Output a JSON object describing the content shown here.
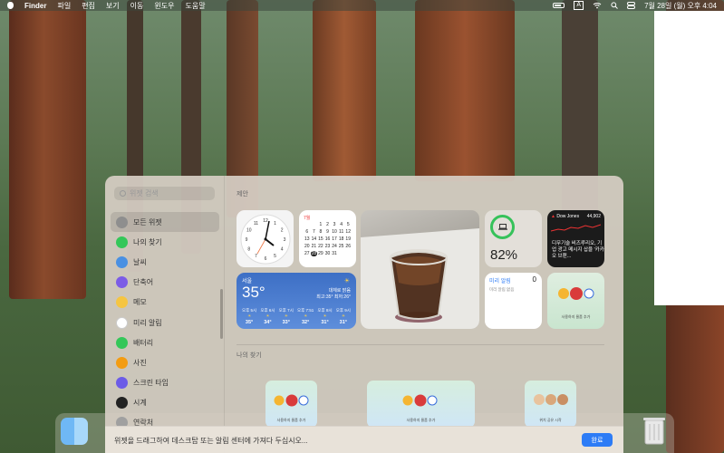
{
  "menubar": {
    "app": "Finder",
    "menus": [
      "파일",
      "편집",
      "보기",
      "이동",
      "윈도우",
      "도움말"
    ],
    "clock": "7월 28일 (월) 오후 4:04",
    "input_indicator": "A"
  },
  "search": {
    "placeholder": "위젯 검색"
  },
  "sidebar": {
    "items": [
      {
        "label": "모든 위젯",
        "icon": "widgets-icon",
        "color": "#8e8e8e"
      },
      {
        "label": "나의 찾기",
        "icon": "find-my-icon",
        "color": "#34c759"
      },
      {
        "label": "날씨",
        "icon": "weather-icon",
        "color": "#4a90e2"
      },
      {
        "label": "단축어",
        "icon": "shortcuts-icon",
        "color": "#7b5ce6"
      },
      {
        "label": "메모",
        "icon": "notes-icon",
        "color": "#f5c542"
      },
      {
        "label": "미리 알림",
        "icon": "reminders-icon",
        "color": "#ffffff"
      },
      {
        "label": "배터리",
        "icon": "battery-icon",
        "color": "#34c759"
      },
      {
        "label": "사진",
        "icon": "photos-icon",
        "color": "#f39c12"
      },
      {
        "label": "스크린 타임",
        "icon": "screen-time-icon",
        "color": "#6c5ce7"
      },
      {
        "label": "시계",
        "icon": "clock-icon",
        "color": "#222222"
      },
      {
        "label": "연락처",
        "icon": "contacts-icon",
        "color": "#a0a0a0"
      }
    ]
  },
  "sections": {
    "suggested": "제안",
    "findmy": "나의 찾기"
  },
  "calendar": {
    "month": "7월",
    "days": [
      "",
      "",
      "1",
      "2",
      "3",
      "4",
      "5",
      "6",
      "7",
      "8",
      "9",
      "10",
      "11",
      "12",
      "13",
      "14",
      "15",
      "16",
      "17",
      "18",
      "19",
      "20",
      "21",
      "22",
      "23",
      "24",
      "25",
      "26",
      "27",
      "28",
      "29",
      "30",
      "31",
      "",
      ""
    ],
    "today": "28"
  },
  "battery": {
    "percent": "82%"
  },
  "stocks": {
    "name": "Dow Jones",
    "value": "44,902",
    "headline": "디무기술 비즈루리오, 기업 광고 메시지 삽을 '카카오 브랜..."
  },
  "weather": {
    "city": "서울",
    "temp": "35°",
    "condition": "대체로 맑음",
    "range": "최고:35° 최저:26°",
    "forecast": [
      {
        "time": "오후 5시",
        "temp": "35°"
      },
      {
        "time": "오후 6시",
        "temp": "34°"
      },
      {
        "time": "오후 7시",
        "temp": "33°"
      },
      {
        "time": "오후 7:51",
        "temp": "32°"
      },
      {
        "time": "오후 8시",
        "temp": "31°"
      },
      {
        "time": "오후 9시",
        "temp": "31°"
      }
    ]
  },
  "reminders": {
    "title": "미리 알림",
    "count": "0",
    "subtitle": "미리 알림 없음"
  },
  "findmy": {
    "label": "사용하지 물품 추가",
    "label_people": "위치 공유 시작"
  },
  "footer": {
    "hint": "위젯을 드래그하여 데스크탑 또는 알림 센터에 가져다 두십시오...",
    "done": "완료"
  }
}
